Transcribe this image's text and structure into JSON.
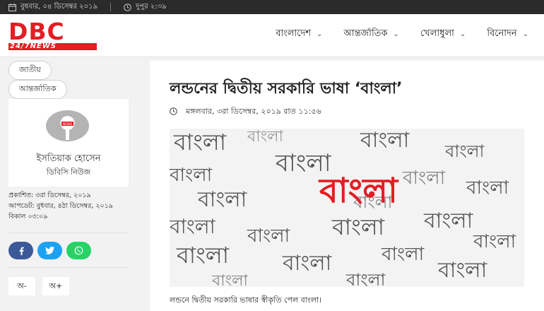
{
  "topbar": {
    "date": "বুধবার, ০৪ ডিসেম্বর ২০১৯",
    "time": "দুপুর ২:৩৯",
    "calendar_icon": "calendar-icon",
    "clock_icon": "clock-icon"
  },
  "logo": {
    "main": "DBC",
    "sub": "24/7NEWS"
  },
  "nav": [
    {
      "label": "বাংলাদেশ"
    },
    {
      "label": "আন্তর্জাতিক"
    },
    {
      "label": "খেলাধুলা"
    },
    {
      "label": "বিনোদন"
    }
  ],
  "tags": [
    "জাতীয়",
    "আন্তর্জাতিক"
  ],
  "author": {
    "name": "ইসতিয়াক হোসেন",
    "org": "ডিবিসি নিউজ",
    "mic_label": "NEWS"
  },
  "meta": {
    "published": "প্রকাশিত: ৩রা ডিসেম্বর, ২০১৯",
    "updated": "আপডেট: বুধবার, ৪ঠা ডিসেম্বর, ২০১৯ বিকাল ০৩:০৯"
  },
  "share": {
    "facebook": "facebook-icon",
    "twitter": "twitter-icon",
    "whatsapp": "whatsapp-icon"
  },
  "font_buttons": {
    "decrease": "অ-",
    "increase": "অ+"
  },
  "article": {
    "title": "লন্ডনের দ্বিতীয় সরকারি ভাষা ‘বাংলা’",
    "date": "মঙ্গলবার, ৩রা ডিসেম্বর, ২০১৯ রাত ১১:৫৬",
    "hero_word": "বাংলা",
    "caption": "লন্ডনে দ্বিতীয় সরকারি ভাষার স্বীকৃতি পেল বাংলা।"
  },
  "colors": {
    "brand": "#e31e24",
    "topbar": "#2b2b2b",
    "facebook": "#3b5998",
    "twitter": "#1da1f2",
    "whatsapp": "#25d366"
  }
}
